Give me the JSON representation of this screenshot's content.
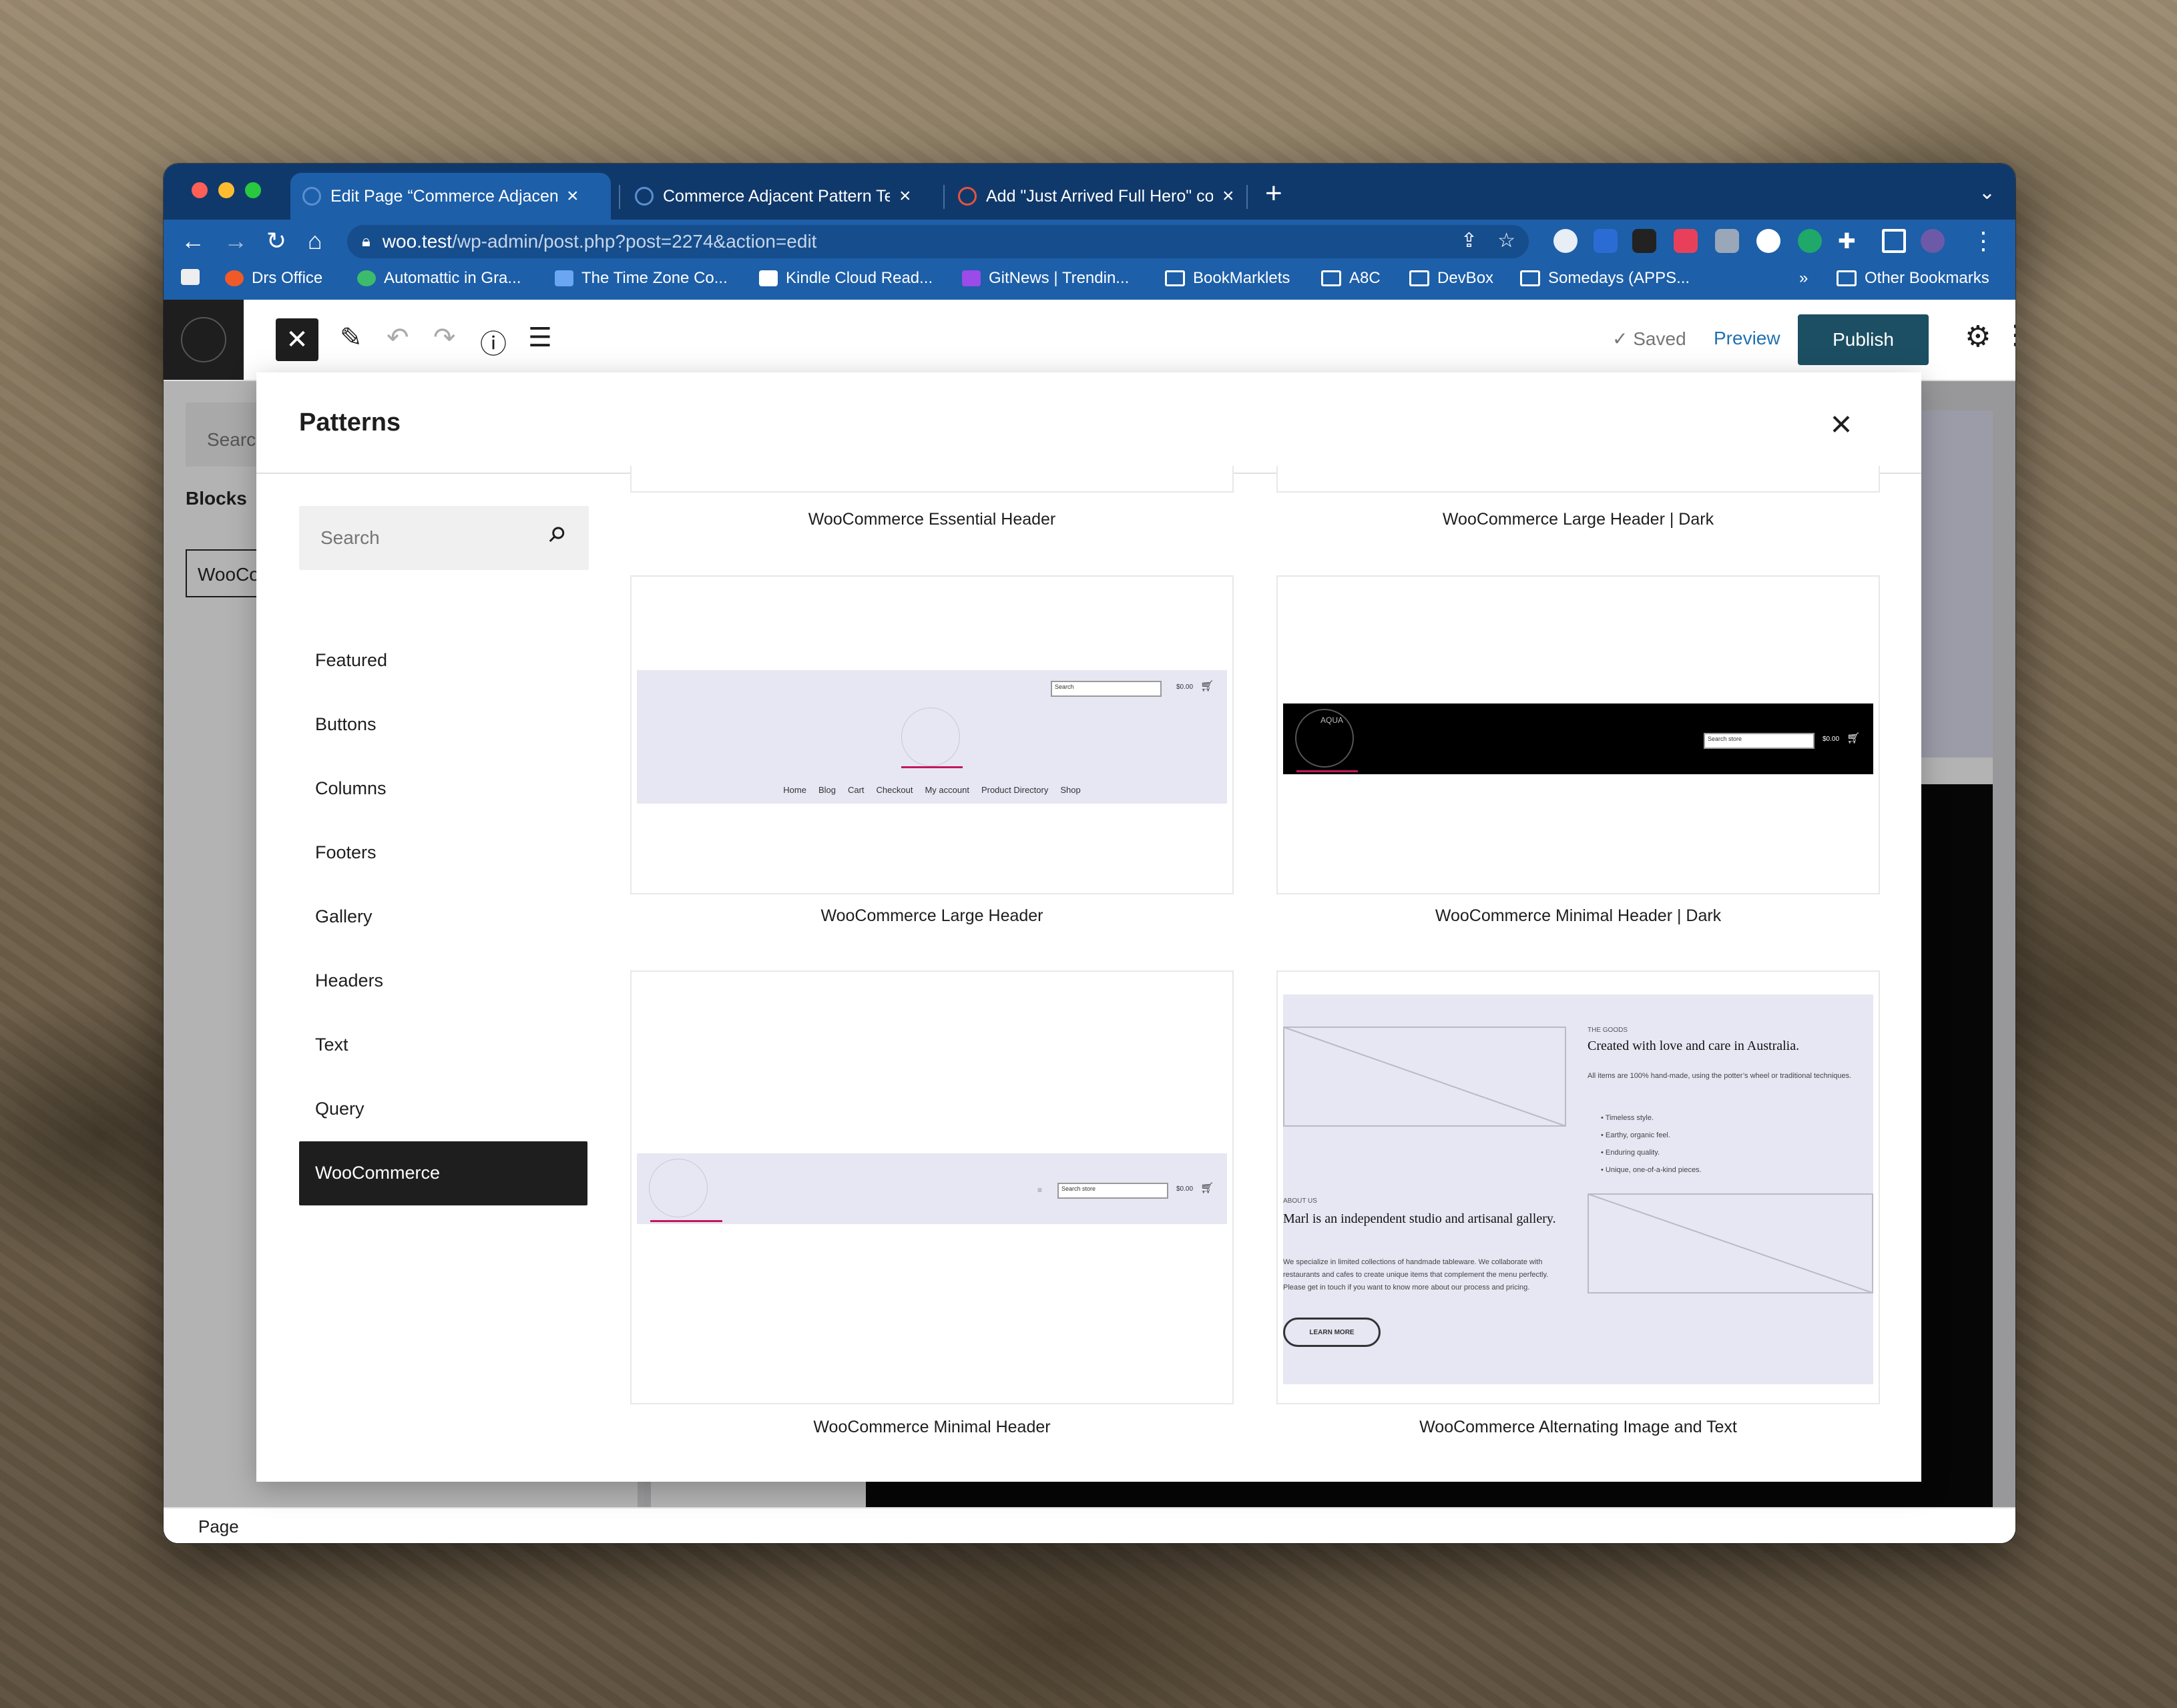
{
  "browser": {
    "tabs": [
      {
        "title": "Edit Page “Commerce Adjacent Pattern Te",
        "close": "×"
      },
      {
        "title": "Commerce Adjacent Pattern Te",
        "close": "×"
      },
      {
        "title": "Add \"Just Arrived Full Hero\" co",
        "close": "×"
      }
    ],
    "url_host": "woo.test",
    "url_path": "/wp-admin/post.php?post=2274&action=edit",
    "bookmarks": [
      "Drs Office",
      "Automattic in Gra...",
      "The Time Zone Co...",
      "Kindle Cloud Read...",
      "GitNews | Trendin...",
      "BookMarklets",
      "A8C",
      "DevBox",
      "Somedays (APPS..."
    ],
    "bookmarks_overflow": "»",
    "other_bookmarks": "Other Bookmarks"
  },
  "editor": {
    "saved_label": "Saved",
    "preview_label": "Preview",
    "publish_label": "Publish",
    "inserter_search_placeholder": "Search",
    "inserter_blocks_label": "Blocks",
    "inserter_woo_label": "WooCo",
    "status_label": "Page"
  },
  "modal": {
    "title": "Patterns",
    "search_placeholder": "Search",
    "categories": [
      "Featured",
      "Buttons",
      "Columns",
      "Footers",
      "Gallery",
      "Headers",
      "Text",
      "Query",
      "WooCommerce"
    ],
    "active_category": "WooCommerce",
    "patterns": [
      {
        "label": "WooCommerce Essential Header"
      },
      {
        "label": "WooCommerce Large Header | Dark"
      },
      {
        "label": "WooCommerce Large Header"
      },
      {
        "label": "WooCommerce Minimal Header | Dark"
      },
      {
        "label": "WooCommerce Minimal Header"
      },
      {
        "label": "WooCommerce Alternating Image and Text"
      }
    ],
    "large_header_preview": {
      "search": "Search",
      "price": "$0.00",
      "nav": [
        "Home",
        "Blog",
        "Cart",
        "Checkout",
        "My account",
        "Product Directory",
        "Shop"
      ]
    },
    "minimal_dark_preview": {
      "search": "Search store",
      "price": "$0.00",
      "logo": "AQUA"
    },
    "minimal_preview": {
      "search": "Search store",
      "price": "$0.00"
    },
    "alternating_preview": {
      "eyebrow1": "THE GOODS",
      "heading1": "Created with love and care in Australia.",
      "body1": "All items are 100% hand-made, using the potter’s wheel or traditional techniques.",
      "bullets": [
        "Timeless style.",
        "Earthy, organic feel.",
        "Enduring quality.",
        "Unique, one-of-a-kind pieces."
      ],
      "eyebrow2": "ABOUT US",
      "heading2": "Marl is an independent studio and artisanal gallery.",
      "body2": "We specialize in limited collections of handmade tableware. We collaborate with restaurants and cafes to create unique items that complement the menu perfectly. Please get in touch if you want to know more about our process and pricing.",
      "button": "LEARN MORE"
    }
  }
}
